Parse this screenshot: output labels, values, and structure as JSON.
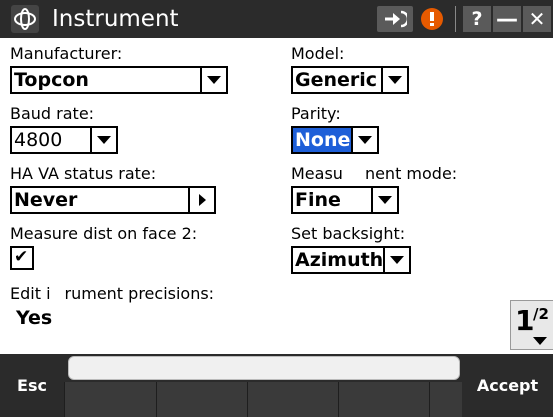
{
  "title_bar": {
    "title": "Instrument",
    "logo_icon": "trimble-globe-icon",
    "connect_icon": "connect-arrow-icon",
    "warning_icon": "warning-icon",
    "warning_color": "#e65a00",
    "help_label": "?",
    "minimize_label": "—",
    "close_label": "✕"
  },
  "form": {
    "manufacturer": {
      "label": "Manufacturer:",
      "value": "Topcon"
    },
    "model": {
      "label": "Model:",
      "value": "Generic"
    },
    "baud_rate": {
      "label": "Baud rate:",
      "value": "4800"
    },
    "parity": {
      "label": "Parity:",
      "value": "None"
    },
    "ha_va_status_rate": {
      "label": "HA VA status rate:",
      "value": "Never"
    },
    "measurement_mode": {
      "label": "Measu",
      "label_end": "nent mode:",
      "value": "Fine"
    },
    "measure_dist_face2": {
      "label": "Measure dist on face 2:",
      "checked": true,
      "check_mark": "✔"
    },
    "set_backsight": {
      "label": "Set backsight:",
      "value": "Azimuth"
    },
    "edit_precisions": {
      "label_start": "Edit i",
      "label_end": "rument precisions:",
      "value": "Yes"
    }
  },
  "pager": {
    "page": "1",
    "total": "/2"
  },
  "softkeys": {
    "left": "Esc",
    "right": "Accept"
  },
  "colors": {
    "accent": "#1e5fd8",
    "bar": "#2b2b2b"
  }
}
